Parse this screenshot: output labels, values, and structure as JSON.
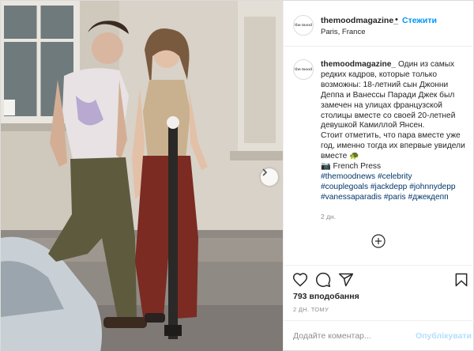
{
  "header": {
    "avatar_text": "the mood",
    "username": "themoodmagazine_",
    "separator": "•",
    "follow_label": "Стежити",
    "location": "Paris, France"
  },
  "caption": {
    "avatar_text": "the mood",
    "username": "themoodmagazine_",
    "text1": "Один из самых редких кадров, которые только возможны: 18-летний сын Джонни Деппа и Ванессы Паради Джек был замечен на улицах французской столицы вместе со своей 20-летней девушкой Камиллой Янсен.",
    "text2": "Стоит отметить, что пара вместе уже год, именно тогда их впервые увидели вместе",
    "text3": "French Press",
    "hashtags": [
      "#themoodnews",
      "#celebrity",
      "#couplegoals",
      "#jackdepp",
      "#johnnydepp",
      "#vanessaparadis",
      "#paris",
      "#джекдепп"
    ],
    "time": "2 дн."
  },
  "actions": {
    "likes": "793 вподобання",
    "post_time": "2 ДН. ТОМУ"
  },
  "add_comment": {
    "placeholder": "Додайте коментар...",
    "publish_label": "Опублікувати"
  },
  "icons": {
    "like": "heart-icon",
    "comment": "comment-icon",
    "share": "paper-plane-icon",
    "save": "bookmark-icon",
    "more": "plus-circle-icon",
    "next": "chevron-right-icon",
    "camera": "camera-emoji",
    "turtle": "turtle-emoji"
  },
  "colors": {
    "link_blue": "#0095f6",
    "hashtag": "#00376b",
    "secondary_text": "#8e8e8e",
    "publish_disabled": "#b2dffc",
    "border": "#dbdbdb"
  }
}
